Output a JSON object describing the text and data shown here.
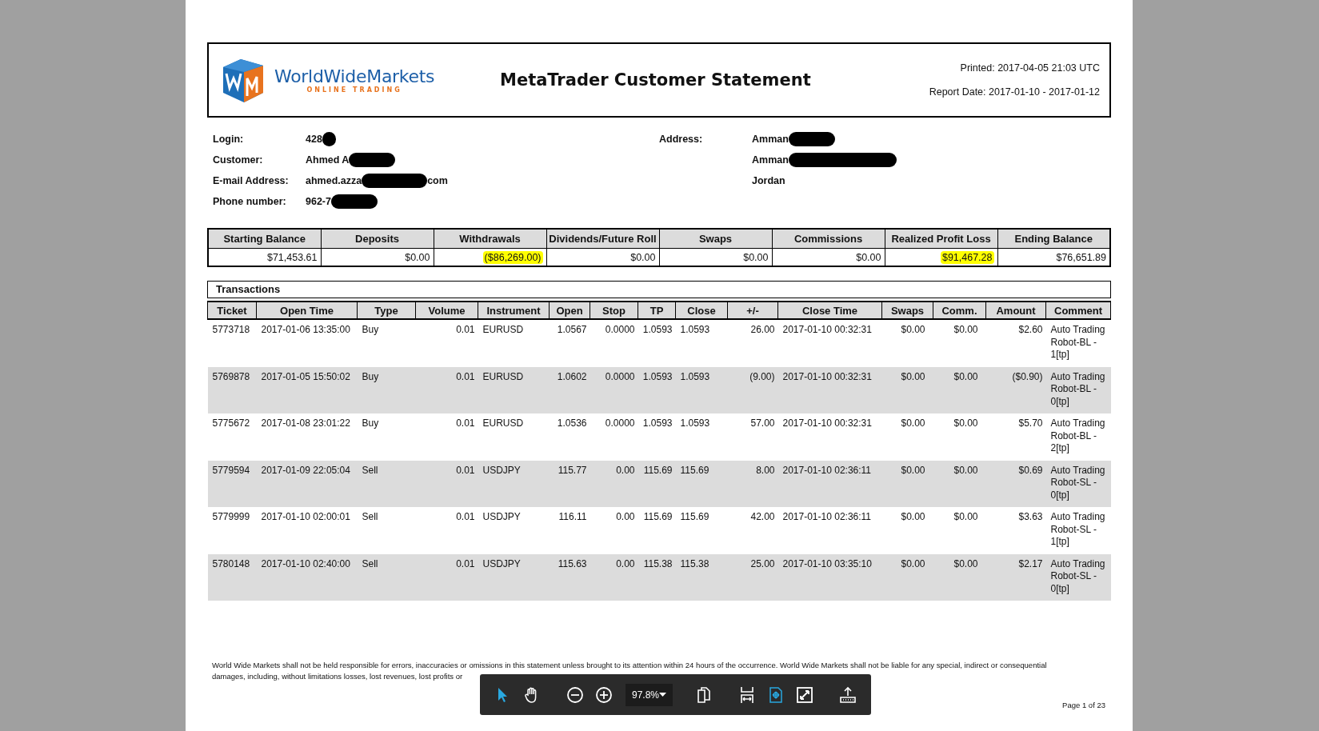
{
  "header": {
    "logo_name": "WorldWideMarkets",
    "logo_tagline": "ONLINE TRADING",
    "title": "MetaTrader Customer Statement",
    "printed": "Printed: 2017-04-05 21:03 UTC",
    "report_date": "Report Date: 2017-01-10 - 2017-01-12"
  },
  "account": {
    "left": [
      {
        "label": "Login:",
        "parts": [
          {
            "kind": "text",
            "text": "428"
          },
          {
            "kind": "redaction"
          }
        ]
      },
      {
        "label": "Customer:",
        "parts": [
          {
            "kind": "text",
            "text": "Ahmed A"
          },
          {
            "kind": "redaction"
          }
        ]
      },
      {
        "label": "E-mail Address:",
        "parts": [
          {
            "kind": "text",
            "text": "ahmed.azza"
          },
          {
            "kind": "redaction"
          },
          {
            "kind": "text",
            "text": "com"
          }
        ]
      },
      {
        "label": "Phone number:",
        "parts": [
          {
            "kind": "text",
            "text": "962-7"
          },
          {
            "kind": "redaction"
          }
        ]
      }
    ],
    "right": [
      {
        "label": "Address:",
        "parts": [
          {
            "kind": "text",
            "text": "Amman"
          },
          {
            "kind": "redaction"
          }
        ]
      },
      {
        "parts": [
          {
            "kind": "text",
            "text": "Amman"
          },
          {
            "kind": "redaction"
          }
        ]
      },
      {
        "parts": [
          {
            "kind": "text",
            "text": "Jordan"
          }
        ]
      }
    ]
  },
  "summary": {
    "columns": [
      "Starting Balance",
      "Deposits",
      "Withdrawals",
      "Dividends/Future Roll",
      "Swaps",
      "Commissions",
      "Realized Profit Loss",
      "Ending Balance"
    ],
    "values": [
      {
        "text": "$71,453.61",
        "highlighted": false
      },
      {
        "text": "$0.00",
        "highlighted": false
      },
      {
        "text": "($86,269.00)",
        "highlighted": true
      },
      {
        "text": "$0.00",
        "highlighted": false
      },
      {
        "text": "$0.00",
        "highlighted": false
      },
      {
        "text": "$0.00",
        "highlighted": false
      },
      {
        "text": "$91,467.28",
        "highlighted": true
      },
      {
        "text": "$76,651.89",
        "highlighted": false
      }
    ]
  },
  "transactions": {
    "title": "Transactions",
    "columns": [
      "Ticket",
      "Open Time",
      "Type",
      "Volume",
      "Instrument",
      "Open",
      "Stop",
      "TP",
      "Close",
      "+/-",
      "Close Time",
      "Swaps",
      "Comm.",
      "Amount",
      "Comment"
    ],
    "rows": [
      [
        "5773718",
        "2017-01-06 13:35:00",
        "Buy",
        "0.01",
        "EURUSD",
        "1.0567",
        "0.0000",
        "1.0593",
        "1.0593",
        "26.00",
        "2017-01-10 00:32:31",
        "$0.00",
        "$0.00",
        "$2.60",
        "Auto Trading Robot-BL - 1[tp]"
      ],
      [
        "5769878",
        "2017-01-05 15:50:02",
        "Buy",
        "0.01",
        "EURUSD",
        "1.0602",
        "0.0000",
        "1.0593",
        "1.0593",
        "(9.00)",
        "2017-01-10 00:32:31",
        "$0.00",
        "$0.00",
        "($0.90)",
        "Auto Trading Robot-BL - 0[tp]"
      ],
      [
        "5775672",
        "2017-01-08 23:01:22",
        "Buy",
        "0.01",
        "EURUSD",
        "1.0536",
        "0.0000",
        "1.0593",
        "1.0593",
        "57.00",
        "2017-01-10 00:32:31",
        "$0.00",
        "$0.00",
        "$5.70",
        "Auto Trading Robot-BL - 2[tp]"
      ],
      [
        "5779594",
        "2017-01-09 22:05:04",
        "Sell",
        "0.01",
        "USDJPY",
        "115.77",
        "0.00",
        "115.69",
        "115.69",
        "8.00",
        "2017-01-10 02:36:11",
        "$0.00",
        "$0.00",
        "$0.69",
        "Auto Trading Robot-SL - 0[tp]"
      ],
      [
        "5779999",
        "2017-01-10 02:00:01",
        "Sell",
        "0.01",
        "USDJPY",
        "116.11",
        "0.00",
        "115.69",
        "115.69",
        "42.00",
        "2017-01-10 02:36:11",
        "$0.00",
        "$0.00",
        "$3.63",
        "Auto Trading Robot-SL - 1[tp]"
      ],
      [
        "5780148",
        "2017-01-10 02:40:00",
        "Sell",
        "0.01",
        "USDJPY",
        "115.63",
        "0.00",
        "115.38",
        "115.38",
        "25.00",
        "2017-01-10 03:35:10",
        "$0.00",
        "$0.00",
        "$2.17",
        "Auto Trading Robot-SL - 0[tp]"
      ]
    ]
  },
  "footer": {
    "disclaimer": [
      "World Wide Markets shall not be held responsible for errors, inaccuracies or omissions in this statement unless brought to its attention within 24 hours of the occurrence. World Wide Markets shall not be liable for any special, indirect or consequential",
      "damages, including, without limitations losses, lost revenues, lost profits or"
    ],
    "page": "Page 1 of 23"
  },
  "toolbar": {
    "tools": [
      {
        "kind": "pointer",
        "selected": true
      },
      {
        "kind": "hand",
        "selected": false
      },
      {
        "kind": "separator"
      },
      {
        "kind": "zoomout",
        "selected": false
      },
      {
        "kind": "zoomin",
        "selected": false
      },
      {
        "kind": "zoom",
        "value": "97.8%"
      },
      {
        "kind": "separator"
      },
      {
        "kind": "pages",
        "selected": false
      },
      {
        "kind": "separator"
      },
      {
        "kind": "fitwidth",
        "selected": false
      },
      {
        "kind": "fitpage",
        "selected": true
      },
      {
        "kind": "fullscreen",
        "selected": false
      },
      {
        "kind": "separator"
      },
      {
        "kind": "share",
        "selected": false
      }
    ]
  }
}
